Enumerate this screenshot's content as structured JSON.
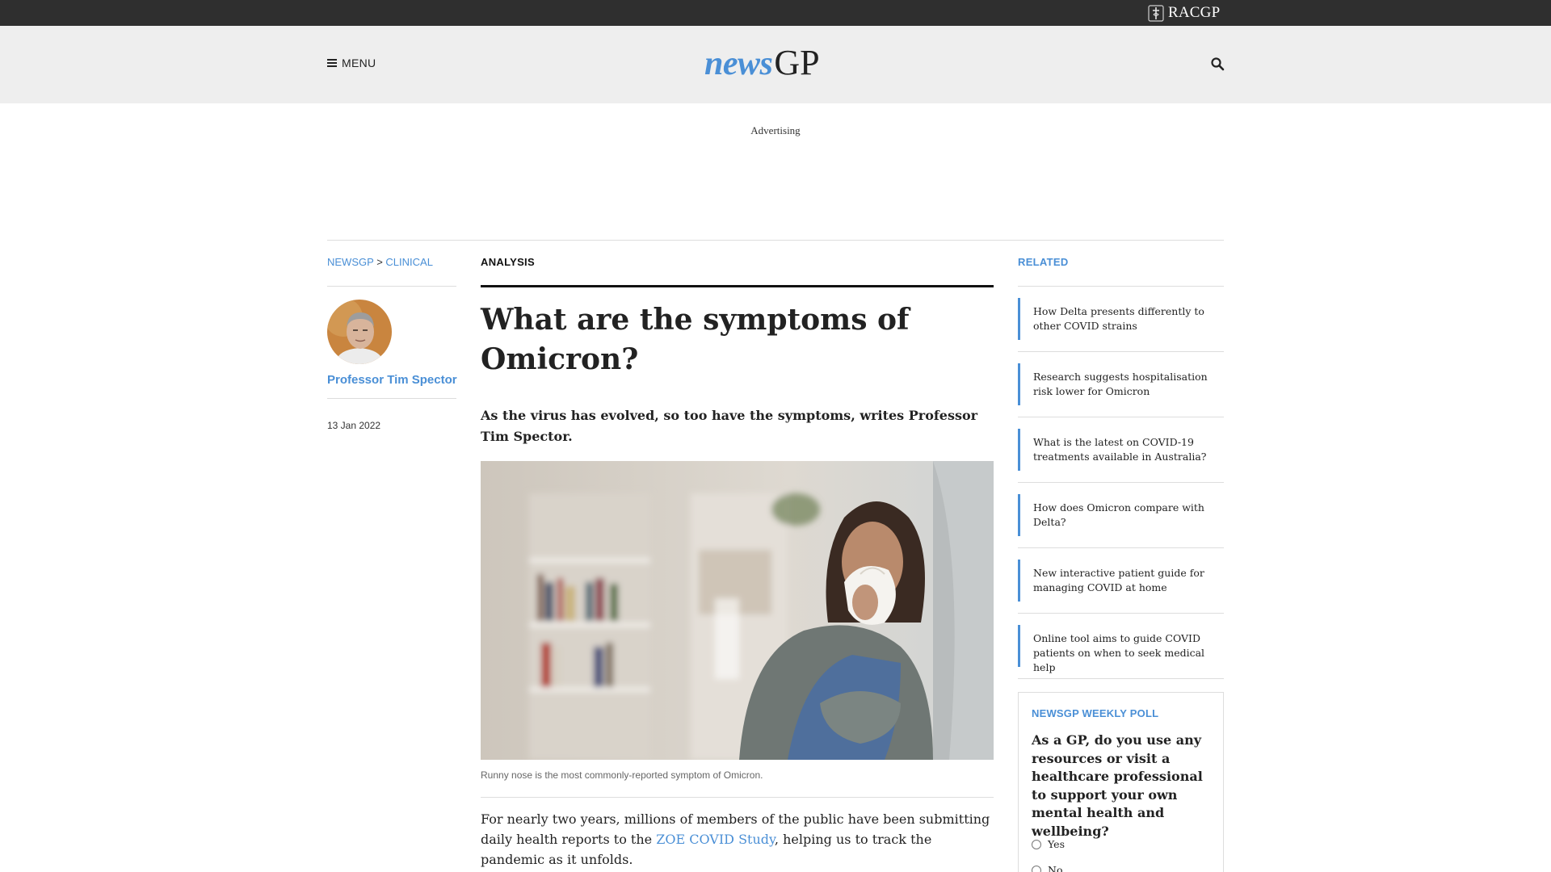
{
  "brand": {
    "org_name": "RACGP",
    "logo_news": "news",
    "logo_gp": "GP",
    "accent_color": "#4a8fd6"
  },
  "header": {
    "menu_label": "MENU",
    "menu_icon": "hamburger-icon",
    "search_icon": "search-icon"
  },
  "ad": {
    "label": "Advertising"
  },
  "breadcrumb": {
    "items": [
      "NEWSGP",
      "CLINICAL"
    ],
    "separator": ">"
  },
  "author": {
    "name": "Professor Tim Spector",
    "date": "13 Jan 2022"
  },
  "article": {
    "kicker": "ANALYSIS",
    "title": "What are the symptoms of Omicron?",
    "standfirst": "As the virus has evolved, so too have the symptoms, writes Professor Tim Spector.",
    "image_caption": "Runny nose is the most commonly-reported symptom of Omicron.",
    "body_before_link": "For nearly two years, millions of members of the public have been submitting daily health reports to the ",
    "body_link": "ZOE COVID Study",
    "body_after_link": ", helping us to track the pandemic as it unfolds."
  },
  "related": {
    "heading": "RELATED",
    "items": [
      "How Delta presents differently to other COVID strains",
      "Research suggests hospitalisation risk lower for Omicron",
      "What is the latest on COVID-19 treatments available in Australia?",
      "How does Omicron compare with Delta?",
      "New interactive patient guide for managing COVID at home",
      "Online tool aims to guide COVID patients on when to seek medical help"
    ]
  },
  "poll": {
    "heading": "NEWSGP WEEKLY POLL",
    "question": "As a GP, do you use any resources or visit a healthcare professional to support your own mental health and wellbeing?",
    "options": [
      "Yes",
      "No"
    ]
  }
}
